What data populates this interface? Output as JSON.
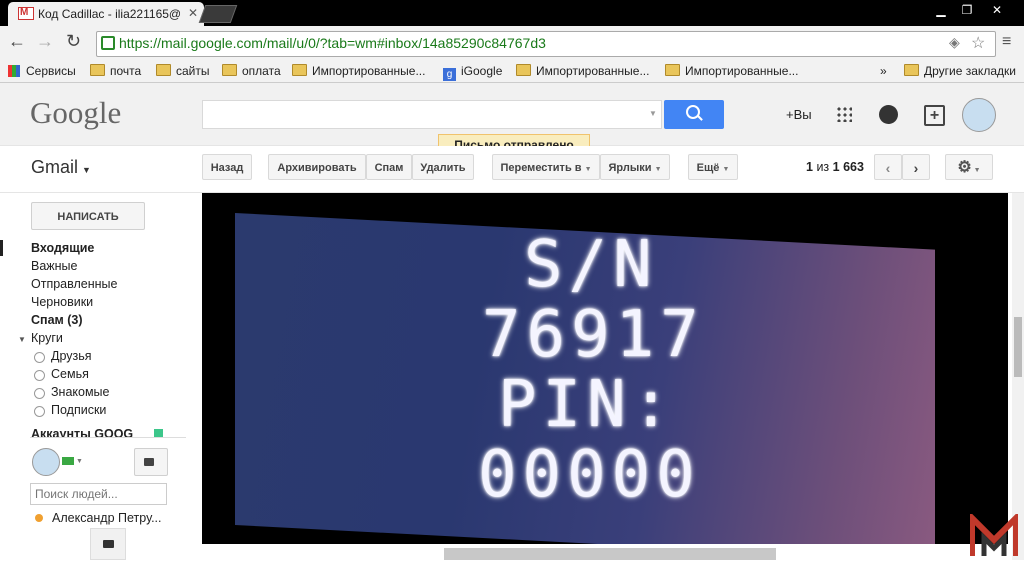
{
  "browser": {
    "tab_title": "Код Cadillac - ilia221165@",
    "url": "https://mail.google.com/mail/u/0/?tab=wm#inbox/14a85290c84767d3",
    "bookmarks": [
      "Сервисы",
      "почта",
      "сайты",
      "оплата",
      "Импортированные...",
      "iGoogle",
      "Импортированные...",
      "Импортированные..."
    ],
    "other_bookmarks": "Другие закладки",
    "overflow": "»"
  },
  "gmail": {
    "logo": "Google",
    "plus_you": "+Вы",
    "toast": "Письмо отправлено",
    "product": "Gmail",
    "toolbar": {
      "back": "Назад",
      "archive": "Архивировать",
      "spam": "Спам",
      "delete": "Удалить",
      "move": "Переместить в",
      "labels": "Ярлыки",
      "more": "Ещё",
      "page_first": "1",
      "page_of": "из",
      "page_total": "1 663"
    },
    "compose": "НАПИСАТЬ",
    "nav": {
      "inbox": "Входящие",
      "important": "Важные",
      "sent": "Отправленные",
      "drafts": "Черновики",
      "spam": "Спам (3)",
      "circles": "Круги",
      "friends": "Друзья",
      "family": "Семья",
      "acquaintances": "Знакомые",
      "subscriptions": "Подписки",
      "accounts": "Аккаунты GOOG"
    },
    "people_search_placeholder": "Поиск людей...",
    "contact": "Александр Петру..."
  },
  "photo": {
    "line1": "S/N",
    "line2": "76917",
    "line3": "PIN:",
    "line4": "00000"
  }
}
